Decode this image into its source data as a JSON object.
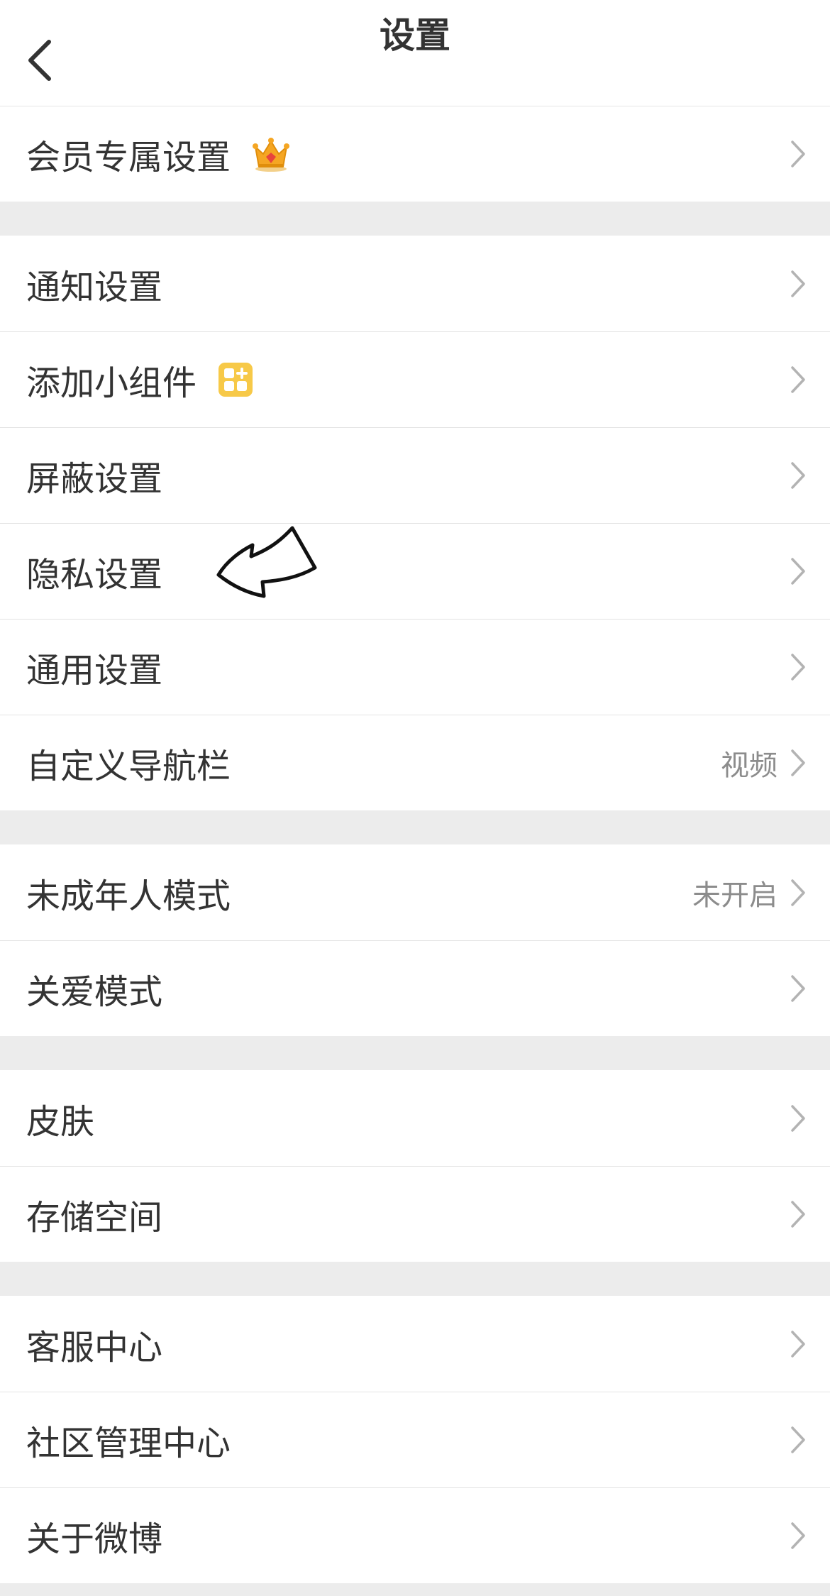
{
  "header": {
    "title": "设置",
    "back_icon": "chevron-left-icon"
  },
  "colors": {
    "background": "#ffffff",
    "separator_band": "#ececec",
    "text_primary": "#333333",
    "text_secondary": "#8c8c8c",
    "chevron": "#b3b3b3",
    "crown": "#f5a623",
    "widget_badge": "#f7c948"
  },
  "groups": [
    {
      "items": [
        {
          "label": "会员专属设置",
          "badge": "crown-icon"
        }
      ]
    },
    {
      "items": [
        {
          "label": "通知设置"
        },
        {
          "label": "添加小组件",
          "badge": "widget-grid-icon"
        },
        {
          "label": "屏蔽设置"
        },
        {
          "label": "隐私设置",
          "annotation": "hand-drawn-arrow"
        },
        {
          "label": "通用设置"
        },
        {
          "label": "自定义导航栏",
          "value": "视频"
        }
      ]
    },
    {
      "items": [
        {
          "label": "未成年人模式",
          "value": "未开启"
        },
        {
          "label": "关爱模式"
        }
      ]
    },
    {
      "items": [
        {
          "label": "皮肤"
        },
        {
          "label": "存储空间"
        }
      ]
    },
    {
      "items": [
        {
          "label": "客服中心"
        },
        {
          "label": "社区管理中心"
        },
        {
          "label": "关于微博"
        }
      ]
    }
  ]
}
